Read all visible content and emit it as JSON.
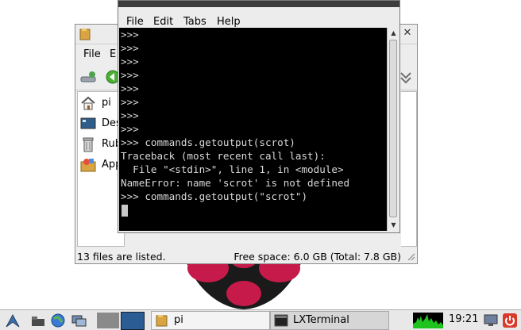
{
  "desktop": {
    "accent_colors": {
      "raspberry": "#c51a4a",
      "leaf": "#6cc04a"
    }
  },
  "file_manager": {
    "menu": [
      "File",
      "E"
    ],
    "sidebar": [
      {
        "label": "pi",
        "icon": "home-folder-icon"
      },
      {
        "label": "Des",
        "icon": "desktop-icon"
      },
      {
        "label": "Rub",
        "icon": "trash-icon"
      },
      {
        "label": "App",
        "icon": "applications-icon"
      }
    ],
    "status_count": "13 files are listed.",
    "status_space": "Free space: 6.0 GB (Total: 7.8 GB)"
  },
  "terminal": {
    "menu": [
      "File",
      "Edit",
      "Tabs",
      "Help"
    ],
    "lines": [
      ">>>",
      ">>>",
      ">>>",
      ">>>",
      ">>>",
      ">>>",
      ">>>",
      ">>>",
      ">>> commands.getoutput(scrot)",
      "Traceback (most recent call last):",
      "  File \"<stdin>\", line 1, in <module>",
      "NameError: name 'scrot' is not defined",
      ">>> commands.getoutput(\"scrot\")"
    ]
  },
  "taskbar": {
    "tasks": [
      {
        "label": "pi",
        "icon": "folder-icon"
      },
      {
        "label": "LXTerminal",
        "icon": "terminal-icon"
      }
    ],
    "clock": "19:21"
  }
}
